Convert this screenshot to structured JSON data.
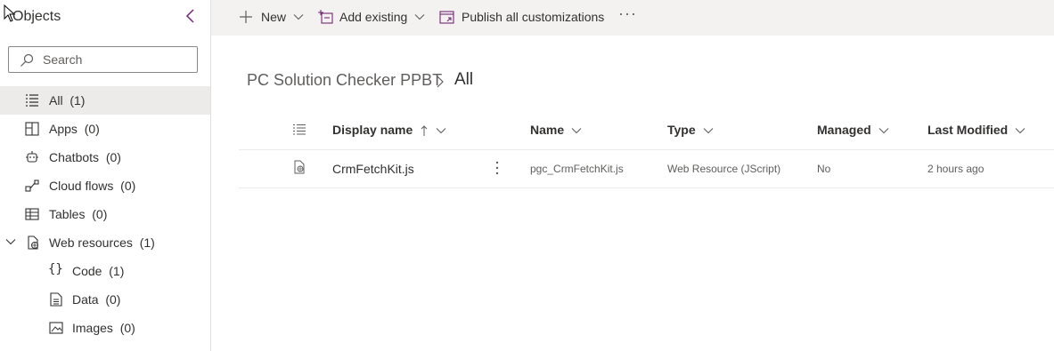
{
  "sidebar": {
    "title": "Objects",
    "search_placeholder": "Search",
    "items": [
      {
        "label": "All",
        "count": "(1)",
        "icon": "list-icon"
      },
      {
        "label": "Apps",
        "count": "(0)",
        "icon": "apps-icon"
      },
      {
        "label": "Chatbots",
        "count": "(0)",
        "icon": "bot-icon"
      },
      {
        "label": "Cloud flows",
        "count": "(0)",
        "icon": "flow-icon"
      },
      {
        "label": "Tables",
        "count": "(0)",
        "icon": "table-icon"
      },
      {
        "label": "Web resources",
        "count": "(1)",
        "icon": "web-resource-icon"
      },
      {
        "label": "Code",
        "count": "(1)",
        "icon": "code-braces-icon"
      },
      {
        "label": "Data",
        "count": "(0)",
        "icon": "document-icon"
      },
      {
        "label": "Images",
        "count": "(0)",
        "icon": "image-icon"
      }
    ]
  },
  "commandbar": {
    "new_label": "New",
    "add_existing_label": "Add existing",
    "publish_label": "Publish all customizations",
    "more_label": "···"
  },
  "breadcrumb": {
    "solution": "PC Solution Checker PPBT",
    "current": "All"
  },
  "grid": {
    "columns": {
      "display_name": "Display name",
      "name": "Name",
      "type": "Type",
      "managed": "Managed",
      "last_modified": "Last Modified"
    },
    "rows": [
      {
        "display_name": "CrmFetchKit.js",
        "name": "pgc_CrmFetchKit.js",
        "type": "Web Resource (JScript)",
        "managed": "No",
        "last_modified": "2 hours ago"
      }
    ]
  },
  "colors": {
    "accent": "#742774",
    "selected_bg": "#edebe9",
    "commandbar_bg": "#f3f2f1"
  }
}
